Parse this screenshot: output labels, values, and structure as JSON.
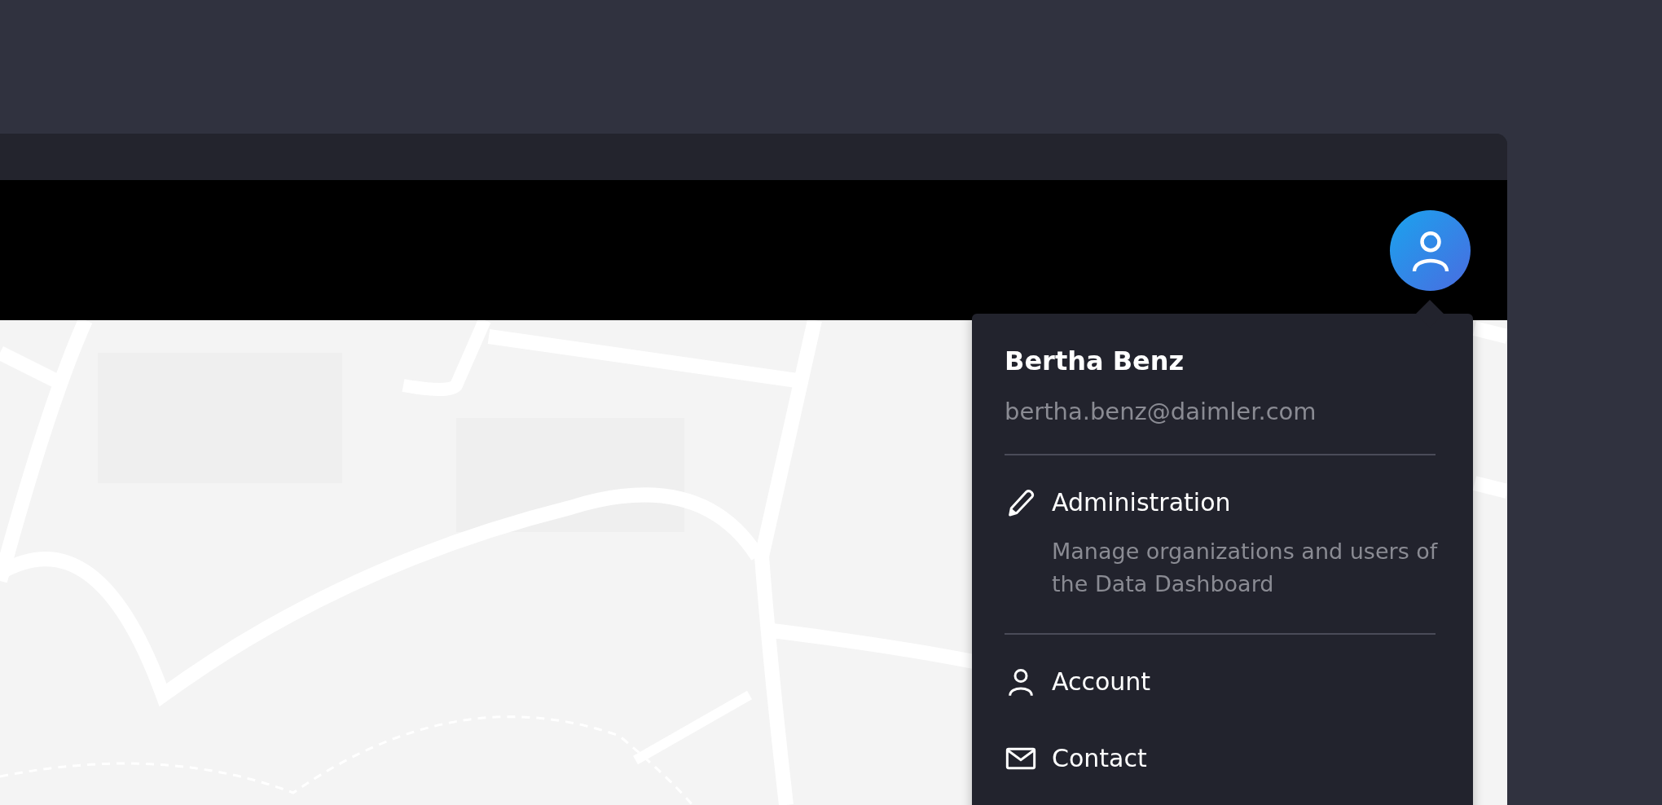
{
  "header": {
    "avatar": {
      "kind": "person"
    }
  },
  "user_menu": {
    "name": "Bertha Benz",
    "email": "bertha.benz@daimler.com",
    "sections": [
      [
        {
          "kind": "pencil",
          "label": "Administration",
          "description": "Manage organizations and users of the Data Dashboard"
        }
      ],
      [
        {
          "kind": "person",
          "label": "Account"
        },
        {
          "kind": "envelope",
          "label": "Contact"
        }
      ]
    ]
  }
}
